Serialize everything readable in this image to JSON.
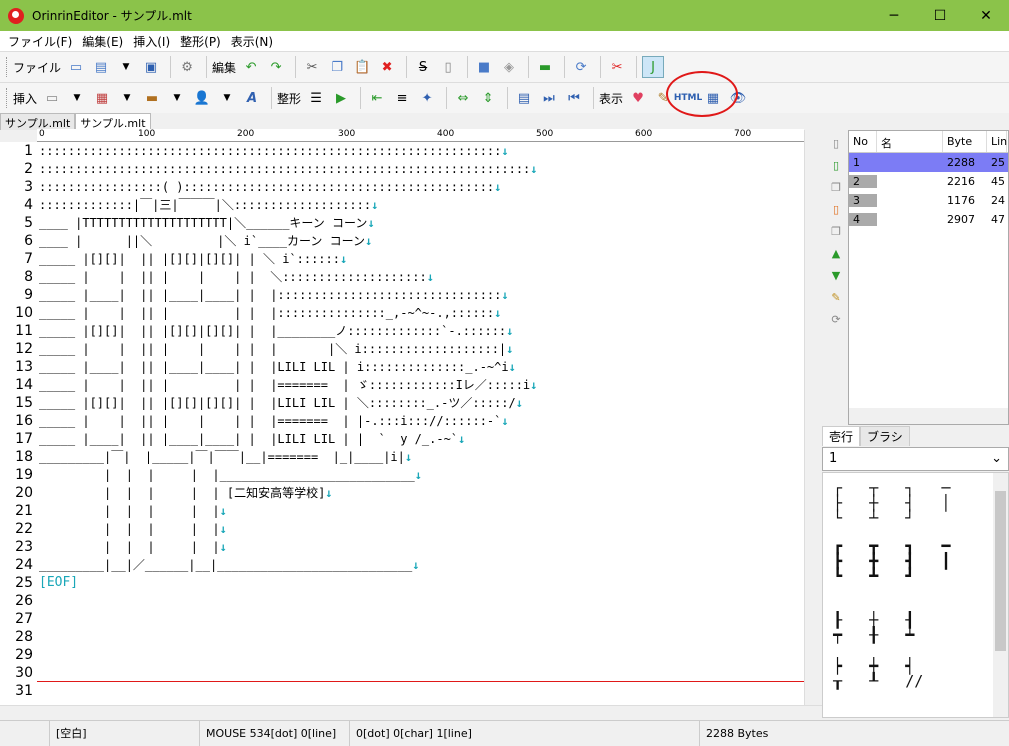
{
  "window": {
    "title": "OrinrinEditor - サンプル.mlt",
    "minimize": "─",
    "maximize": "☐",
    "close": "✕"
  },
  "menu": [
    "ファイル(F)",
    "編集(E)",
    "挿入(I)",
    "整形(P)",
    "表示(N)"
  ],
  "toolbar1": {
    "file_label": "ファイル",
    "edit_label": "編集"
  },
  "toolbar2": {
    "insert_label": "挿入",
    "format_label": "整形",
    "view_label": "表示",
    "html_label": "HTML"
  },
  "tabs": [
    "サンプル.mlt",
    "サンプル.mlt"
  ],
  "ruler_ticks": [
    "0",
    "100",
    "200",
    "300",
    "400",
    "500",
    "600",
    "700"
  ],
  "line_numbers": [
    "1",
    "2",
    "3",
    "4",
    "5",
    "6",
    "7",
    "8",
    "9",
    "10",
    "11",
    "12",
    "13",
    "14",
    "15",
    "16",
    "17",
    "18",
    "19",
    "20",
    "21",
    "22",
    "23",
    "24",
    "25",
    "26",
    "27",
    "28",
    "29",
    "30",
    "31"
  ],
  "editor_lines": [
    {
      "text": "::::::::::::::::::::::::::::::::::::::::::::::::::::::::::::::::",
      "arrow": "↓"
    },
    {
      "text": "::::::::::::::::::::::::::::::::::::::::::::::::::::::::::::::::::::",
      "arrow": "↓"
    },
    {
      "text": ":::::::::::::::::( ):::::::::::::::::::::::::::::::::::::::::::",
      "arrow": "↓"
    },
    {
      "text": ":::::::::::::|￣|三|￣￣￣|＼:::::::::::::::::::",
      "arrow": "↓"
    },
    {
      "text": "____ |TTTTTTTTTTTTTTTTTTTT|＼______キーン コーン",
      "arrow": "↓"
    },
    {
      "text": "____ |      ||＼         |＼ i`____カーン コーン",
      "arrow": "↓"
    },
    {
      "text": "_____ |[][]|  || |[][]|[][]| | ＼ i`::::::",
      "arrow": "↓"
    },
    {
      "text": "_____ |    |  || |    |    | |  ＼::::::::::::::::::::",
      "arrow": "↓"
    },
    {
      "text": "_____ |____|  || |____|____| |  |:::::::::::::::::::::::::::::::",
      "arrow": "↓"
    },
    {
      "text": "_____ |    |  || |         | |  |:::::::::::::::_,-~^~-.,::::::",
      "arrow": "↓"
    },
    {
      "text": "_____ |[][]|  || |[][]|[][]| |  |________ノ:::::::::::::`-.::::::",
      "arrow": "↓"
    },
    {
      "text": "_____ |    |  || |    |    | |  |       |＼ i:::::::::::::::::::|",
      "arrow": "↓"
    },
    {
      "text": "_____ |____|  || |____|____| |  |LILI LIL | i::::::::::::::_.-~^i",
      "arrow": "↓"
    },
    {
      "text": "_____ |    |  || |         | |  |=======  | ゞ::::::::::::Iレ／:::::i",
      "arrow": "↓"
    },
    {
      "text": "_____ |[][]|  || |[][]|[][]| |  |LILI LIL | ＼::::::::_.-ツ／:::::/",
      "arrow": "↓"
    },
    {
      "text": "_____ |    |  || |    |    | |  |=======  | |-.:::i::://::::::-`",
      "arrow": "↓"
    },
    {
      "text": "_____ |____|  || |____|____| |  |LILI LIL | |  `  y /_.-~`",
      "arrow": "↓"
    },
    {
      "text": "_________|￣|  |_____|￣|￣￣|__|=======  |_|____|i|",
      "arrow": "↓"
    },
    {
      "text": "         |  |  |     |  |___________________________",
      "arrow": "↓"
    },
    {
      "text": "         |  |  |     |  | [二知安高等学校]",
      "arrow": "↓"
    },
    {
      "text": "         |  |  |     |  |",
      "arrow": "↓"
    },
    {
      "text": "         |  |  |     |  |",
      "arrow": "↓"
    },
    {
      "text": "         |  |  |     |  |",
      "arrow": "↓"
    },
    {
      "text": "_________|__|／______|__|___________________________",
      "arrow": "↓"
    }
  ],
  "eof": "[EOF]",
  "list_panel": {
    "headers": [
      "No",
      "名",
      "Byte",
      "Lin"
    ],
    "rows": [
      {
        "no": "1",
        "name": "",
        "byte": "2288",
        "lines": "25"
      },
      {
        "no": "2",
        "name": "",
        "byte": "2216",
        "lines": "45"
      },
      {
        "no": "3",
        "name": "",
        "byte": "1176",
        "lines": "24"
      },
      {
        "no": "4",
        "name": "",
        "byte": "2907",
        "lines": "47"
      }
    ]
  },
  "right_tabs": [
    "壱行",
    "ブラシ"
  ],
  "combo_value": "1",
  "brush_glyphs": [
    "┌   ┬   ┐   ─",
    "├   ┼   ┤   │",
    "└   ┴   ┘",
    "┏   ┳   ┓   ━",
    "┣   ╋   ┫   ┃",
    "┗   ┻   ┛",
    "┠   ┼   ┨",
    "┯   ╂   ┷",
    "┝   ┿   ┥",
    "┰   ┸   //"
  ],
  "status": {
    "mode": "[空白]",
    "mouse": "MOUSE 534[dot] 0[line]",
    "cursor": "0[dot] 0[char] 1[line]",
    "bytes": "2288 Bytes"
  }
}
